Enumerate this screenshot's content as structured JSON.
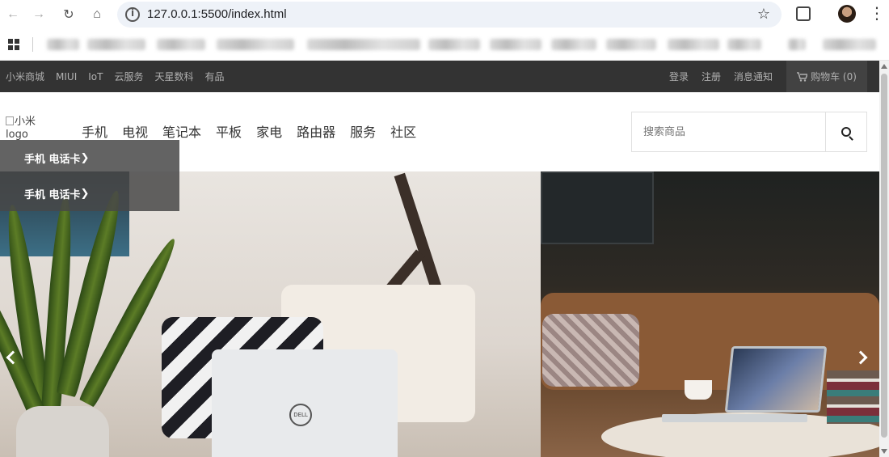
{
  "browser": {
    "url": "127.0.0.1:5500/index.html",
    "icons": [
      "back-icon",
      "forward-icon",
      "reload-icon",
      "home-icon",
      "info-icon",
      "bookmark-star-icon",
      "extensions-icon",
      "profile-avatar",
      "menu-icon",
      "apps-icon"
    ]
  },
  "topbar": {
    "links": [
      "小米商城",
      "MIUI",
      "IoT",
      "云服务",
      "天星数科",
      "有品"
    ],
    "login": "登录",
    "register": "注册",
    "messages": "消息通知",
    "cart": "购物车 (0)"
  },
  "header": {
    "logo_alt": "小米logo",
    "nav": [
      "手机",
      "电视",
      "笔记本",
      "平板",
      "家电",
      "路由器",
      "服务",
      "社区"
    ],
    "search_placeholder": "搜索商品"
  },
  "category_menu": {
    "items": [
      "手机 电话卡",
      "手机 电话卡"
    ]
  },
  "colors": {
    "topbar_bg": "#333333",
    "cart_bg": "#424242",
    "category_bg": "#484848"
  }
}
